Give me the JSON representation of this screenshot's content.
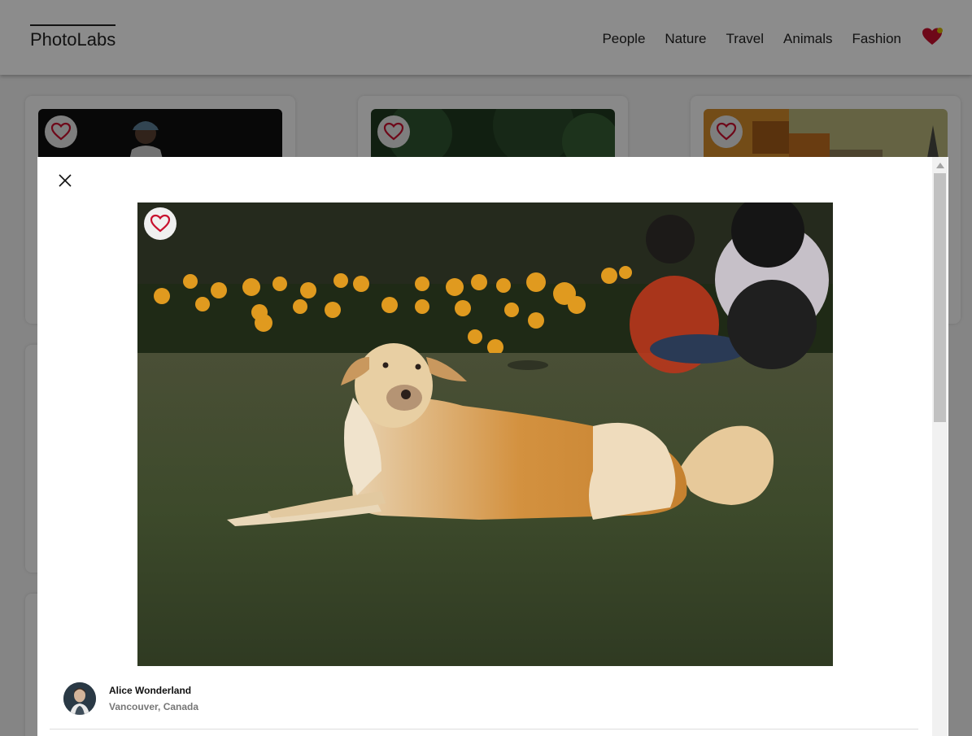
{
  "app": {
    "logo": "PhotoLabs"
  },
  "nav": {
    "topics": [
      "People",
      "Nature",
      "Travel",
      "Animals",
      "Fashion"
    ]
  },
  "colors": {
    "heart_outline": "#c8102e",
    "heart_filled": "#c8102e",
    "notification_dot": "#d4b800"
  },
  "modal": {
    "photo_subject": "dog-lying-on-grass",
    "user": {
      "name": "Alice Wonderland",
      "location": "Vancouver, Canada"
    }
  }
}
